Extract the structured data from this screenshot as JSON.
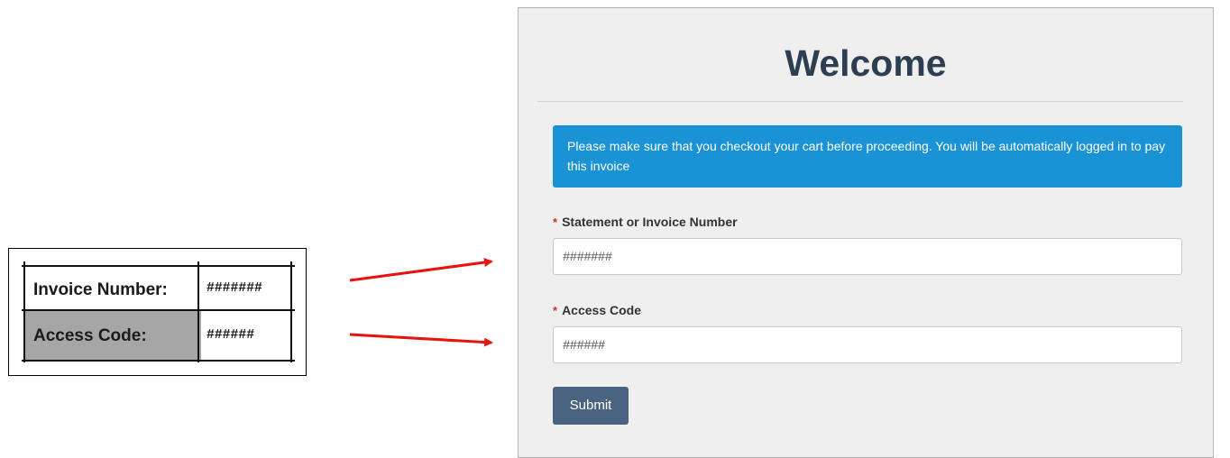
{
  "snippet": {
    "rows": [
      {
        "label": "Invoice Number:",
        "value": "#######"
      },
      {
        "label": "Access Code:",
        "value": "######"
      }
    ]
  },
  "form": {
    "title": "Welcome",
    "info": "Please make sure that you checkout your cart before proceeding. You will be automatically logged in to pay this invoice",
    "required_mark": "*",
    "invoice_label": "Statement or Invoice Number",
    "invoice_value": "#######",
    "access_label": "Access Code",
    "access_value": "######",
    "submit_label": "Submit"
  },
  "colors": {
    "arrow": "#e8130f",
    "info_bg": "#1992d6",
    "button_bg": "#4a6380",
    "title": "#2c3e50",
    "snippet_gray": "#a6a6a6"
  }
}
